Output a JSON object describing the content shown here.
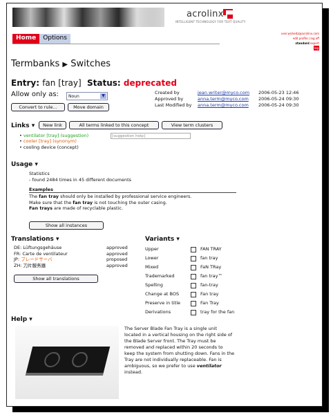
{
  "header": {
    "logo_text": "acrolinx",
    "logo_tagline": "INTELLIGENT TECHNOLOGY FOR TEXT QUALITY",
    "brand_color": "#e0001a"
  },
  "nav": {
    "home": "Home",
    "options": "Options"
  },
  "user": {
    "email": "user.wickedz@acrolinx.com",
    "profile": "edit profile | log off",
    "role": "standard",
    "role_extra": "expert",
    "logout": "log"
  },
  "breadcrumb": {
    "root": "Termbanks",
    "arrow": "▶",
    "current": "Switches"
  },
  "entry": {
    "label": "Entry:",
    "term": "fan [tray]",
    "status_label": "Status:",
    "status": "deprecated",
    "allow_label": "Allow only as:",
    "allow_value": "Noun",
    "convert_button": "Convert to rule...",
    "move_button": "Move domain"
  },
  "meta": [
    {
      "key": "Created by",
      "user": "jean.writer@myco.com",
      "date": "2006-05-23 12:46"
    },
    {
      "key": "Approved by",
      "user": "anna.term@myco.com",
      "date": "2006-05-24 09:30"
    },
    {
      "key": "Last Modified by",
      "user": "anna.term@myco.com",
      "date": "2006-05-24 09:30"
    }
  ],
  "links": {
    "title": "Links ▾",
    "new_link": "New link",
    "all_terms": "All terms linked to this concept",
    "view_clusters": "View term clusters",
    "items": [
      "ventilator [tray] (suggestion)",
      "cooler [tray] (synonym)",
      "cooling device (concept)"
    ],
    "suggestion_placeholder": "[suggestion help]"
  },
  "usage": {
    "title": "Usage ▾",
    "stats_label": "Statistics",
    "stats": "- found 2484 times in 45 different documents",
    "examples_title": "Examples",
    "examples": [
      {
        "pre": "The ",
        "bold": "fan tray",
        "post": " should only be installed by professional service engineers."
      },
      {
        "pre": "Make sure that the ",
        "bold": "fan tray",
        "post": " is not touching the outer casing."
      },
      {
        "pre": "",
        "bold": "Fan trays",
        "post": " are made of recyclable plastic."
      }
    ],
    "show_all": "Show all instances"
  },
  "translations": {
    "title": "Translations ▾",
    "items": [
      {
        "lang": "DE:",
        "term": "Lüftungsgehäuse",
        "status": "approved"
      },
      {
        "lang": "FR:",
        "term": "Carte de ventilateur",
        "status": "approved"
      },
      {
        "lang": "JP:",
        "term": "ブレードサーバ",
        "status": "proposed"
      },
      {
        "lang": "ZH:",
        "term": "刀片服务器",
        "status": "approved"
      }
    ],
    "show_all": "Show all translations"
  },
  "variants": {
    "title": "Variants ▾",
    "items": [
      {
        "key": "Upper",
        "value": "FAN TRAY"
      },
      {
        "key": "Lower",
        "value": "fan tray"
      },
      {
        "key": "Mixed",
        "value": "FaN TRay"
      },
      {
        "key": "Trademarked",
        "value": "fan tray™"
      },
      {
        "key": "Spelling",
        "value": "fan-tray"
      },
      {
        "key": "Change at BOS",
        "value": "Fan tray"
      },
      {
        "key": "Preserve in title",
        "value": "Fan Tray"
      },
      {
        "key": "Derivations",
        "value": "tray for the fan"
      }
    ]
  },
  "help": {
    "title": "Help ▾",
    "text_pre": "The Server Blade Fan Tray is a single unit located in a vertical housing on the right side of the Blade Server front. The Tray must be removed and replaced within 20 seconds to keep the system from shutting down. Fans in the Tray are not individually replaceable. Fan is ambiguous, so we prefer to use ",
    "text_em": "ventilator",
    "text_post": " instead."
  }
}
